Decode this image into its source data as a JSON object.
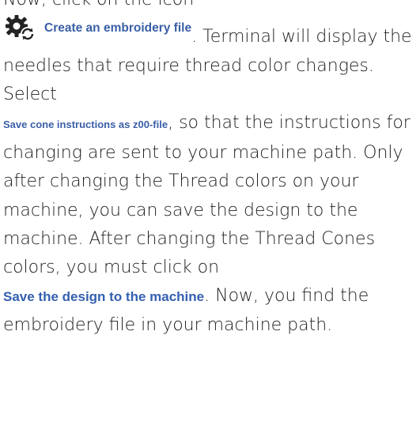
{
  "doc": {
    "intro": "Now, click on the icon",
    "create_file_label": "Create an embroidery file",
    "after_create": ". Terminal will display the needles that require thread color changes. Select",
    "save_cone_label": "Save cone instructions as z00-file",
    "after_save_cone": ", so that the instructions for changing are sent to your machine path. Only after changing the Thread colors on your machine, you can save the design to the machine.  After changing the Thread Cones colors, you must click on",
    "save_design_label": "Save the design to the machine",
    "after_save_design": ". Now, you find the embroidery file in your machine path."
  },
  "icons": {
    "create_file_icon": "gear-refresh-icon"
  },
  "colors": {
    "link_blue": "#3a5fa6",
    "text": "#1f1f1f"
  }
}
